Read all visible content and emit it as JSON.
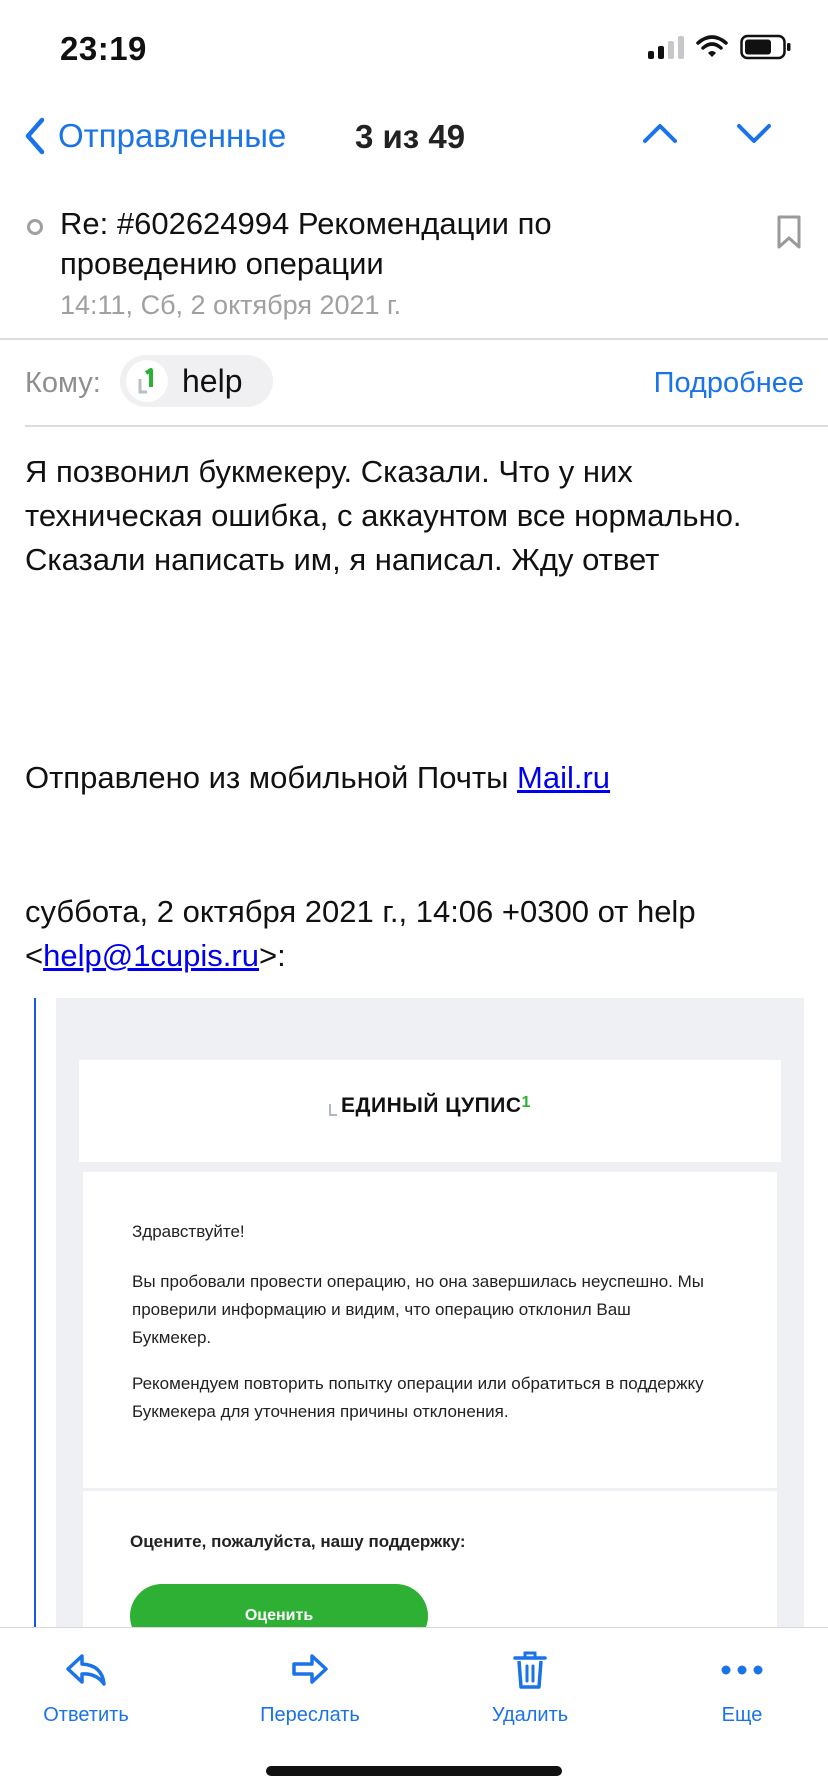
{
  "status_bar": {
    "time": "23:19",
    "icons": [
      "signal-icon",
      "wifi-icon",
      "battery-icon"
    ]
  },
  "nav": {
    "back_label": "Отправленные",
    "counter": "3 из 49",
    "icons": [
      "chevron-left-icon",
      "chevron-up-icon",
      "chevron-down-icon"
    ]
  },
  "message": {
    "subject": "Re: #602624994 Рекомендации по проведению операции",
    "date": "14:11, Сб, 2 октября 2021 г.",
    "to_label": "Кому:",
    "recipient": "help",
    "details_label": "Подробнее",
    "body": "Я позвонил букмекеру. Сказали. Что у них техническая ошибка, с аккаунтом все нормально. Сказали написать им, я написал. Жду ответ",
    "sent_from_prefix": "Отправлено из мобильной Почты ",
    "sent_from_link": "Mail.ru",
    "quote_header_prefix": "суббота, 2 октября 2021 г., 14:06 +0300 от help <",
    "quote_header_email": "help@1cupis.ru",
    "quote_header_suffix": ">:"
  },
  "quoted": {
    "brand": "ЕДИНЫЙ ЦУПИС",
    "brand_sup": "1",
    "greeting": "Здравствуйте!",
    "paragraph1": "Вы пробовали провести операцию, но она завершилась неуспешно. Мы проверили информацию и видим, что операцию отклонил Ваш Букмекер.",
    "paragraph2": "Рекомендуем повторить попытку операции или обратиться в поддержку Букмекера для уточнения причины отклонения.",
    "rate_prompt": "Оцените, пожалуйста, нашу поддержку:",
    "rate_button": "Оценить"
  },
  "toolbar": {
    "reply": "Ответить",
    "forward": "Переслать",
    "delete": "Удалить",
    "more": "Еще"
  },
  "colors": {
    "accent": "#1a73e8",
    "brand_green": "#2db034",
    "link": "#0000ee"
  }
}
